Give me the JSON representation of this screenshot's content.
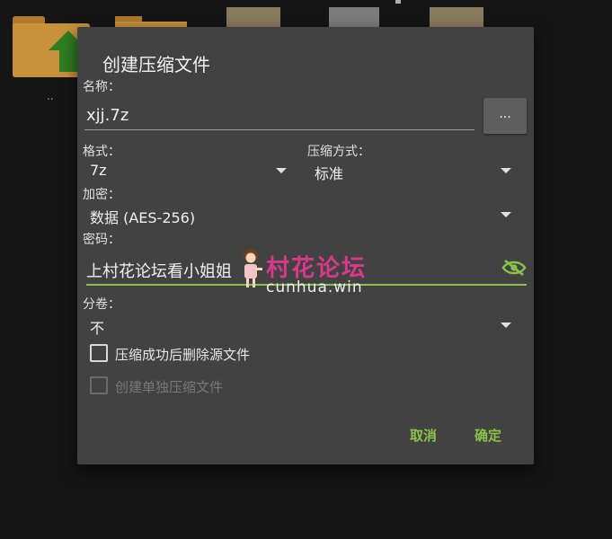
{
  "background": {
    "parent_label": ".."
  },
  "dialog": {
    "title": "创建压缩文件",
    "name_label": "名称：",
    "name_value": "xjj.7z",
    "browse_label": "...",
    "format_label": "格式：",
    "format_value": "7z",
    "method_label": "压缩方式：",
    "method_value": "标准",
    "encrypt_label": "加密：",
    "encrypt_value": "数据 (AES-256)",
    "password_label": "密码：",
    "password_value": "上村花论坛看小姐姐",
    "split_label": "分卷：",
    "split_value": "不",
    "delete_source_label": "压缩成功后删除源文件",
    "delete_source_checked": false,
    "separate_archives_label": "创建单独压缩文件",
    "separate_archives_enabled": false,
    "cancel_label": "取消",
    "ok_label": "确定"
  },
  "watermark": {
    "line1": "村花论坛",
    "line2": "cunhua.win"
  },
  "colors": {
    "accent": "#8bc34a",
    "dialog_bg": "#424242",
    "watermark_pink": "#d8398a"
  }
}
